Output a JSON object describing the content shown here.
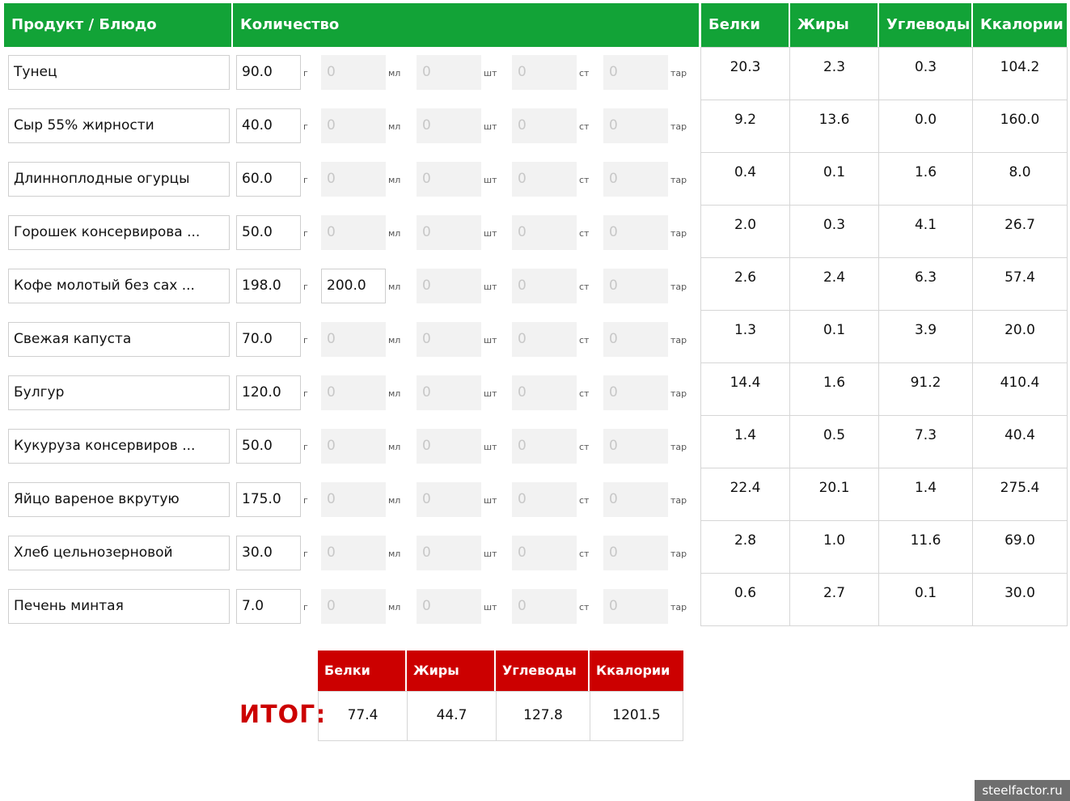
{
  "headers": {
    "product": "Продукт / Блюдо",
    "quantity": "Количество",
    "protein": "Белки",
    "fat": "Жиры",
    "carbs": "Углеводы",
    "kcal": "Ккалории"
  },
  "units": {
    "g": "г",
    "ml": "мл",
    "pcs": "шт",
    "glass": "ст",
    "tare": "тар"
  },
  "rows": [
    {
      "name": "Тунец",
      "g": "90.0",
      "ml": "0",
      "pcs": "0",
      "glass": "0",
      "tare": "0",
      "protein": "20.3",
      "fat": "2.3",
      "carbs": "0.3",
      "kcal": "104.2"
    },
    {
      "name": "Сыр 55% жирности",
      "g": "40.0",
      "ml": "0",
      "pcs": "0",
      "glass": "0",
      "tare": "0",
      "protein": "9.2",
      "fat": "13.6",
      "carbs": "0.0",
      "kcal": "160.0"
    },
    {
      "name": "Длинноплодные огурцы",
      "g": "60.0",
      "ml": "0",
      "pcs": "0",
      "glass": "0",
      "tare": "0",
      "protein": "0.4",
      "fat": "0.1",
      "carbs": "1.6",
      "kcal": "8.0"
    },
    {
      "name": "Горошек консервирова ...",
      "g": "50.0",
      "ml": "0",
      "pcs": "0",
      "glass": "0",
      "tare": "0",
      "protein": "2.0",
      "fat": "0.3",
      "carbs": "4.1",
      "kcal": "26.7"
    },
    {
      "name": "Кофе молотый без сах ...",
      "g": "198.0",
      "ml": "200.0",
      "pcs": "0",
      "glass": "0",
      "tare": "0",
      "protein": "2.6",
      "fat": "2.4",
      "carbs": "6.3",
      "kcal": "57.4"
    },
    {
      "name": "Свежая капуста",
      "g": "70.0",
      "ml": "0",
      "pcs": "0",
      "glass": "0",
      "tare": "0",
      "protein": "1.3",
      "fat": "0.1",
      "carbs": "3.9",
      "kcal": "20.0"
    },
    {
      "name": "Булгур",
      "g": "120.0",
      "ml": "0",
      "pcs": "0",
      "glass": "0",
      "tare": "0",
      "protein": "14.4",
      "fat": "1.6",
      "carbs": "91.2",
      "kcal": "410.4"
    },
    {
      "name": "Кукуруза консервиров ...",
      "g": "50.0",
      "ml": "0",
      "pcs": "0",
      "glass": "0",
      "tare": "0",
      "protein": "1.4",
      "fat": "0.5",
      "carbs": "7.3",
      "kcal": "40.4"
    },
    {
      "name": "Яйцо вареное вкрутую",
      "g": "175.0",
      "ml": "0",
      "pcs": "0",
      "glass": "0",
      "tare": "0",
      "protein": "22.4",
      "fat": "20.1",
      "carbs": "1.4",
      "kcal": "275.4"
    },
    {
      "name": "Хлеб цельнозерновой",
      "g": "30.0",
      "ml": "0",
      "pcs": "0",
      "glass": "0",
      "tare": "0",
      "protein": "2.8",
      "fat": "1.0",
      "carbs": "11.6",
      "kcal": "69.0"
    },
    {
      "name": "Печень минтая",
      "g": "7.0",
      "ml": "0",
      "pcs": "0",
      "glass": "0",
      "tare": "0",
      "protein": "0.6",
      "fat": "2.7",
      "carbs": "0.1",
      "kcal": "30.0"
    }
  ],
  "totals": {
    "label": "ИТОГ:",
    "protein": "77.4",
    "fat": "44.7",
    "carbs": "127.8",
    "kcal": "1201.5"
  },
  "watermark": "steelfactor.ru",
  "colors": {
    "header_green": "#12a337",
    "total_red": "#cc0000"
  }
}
